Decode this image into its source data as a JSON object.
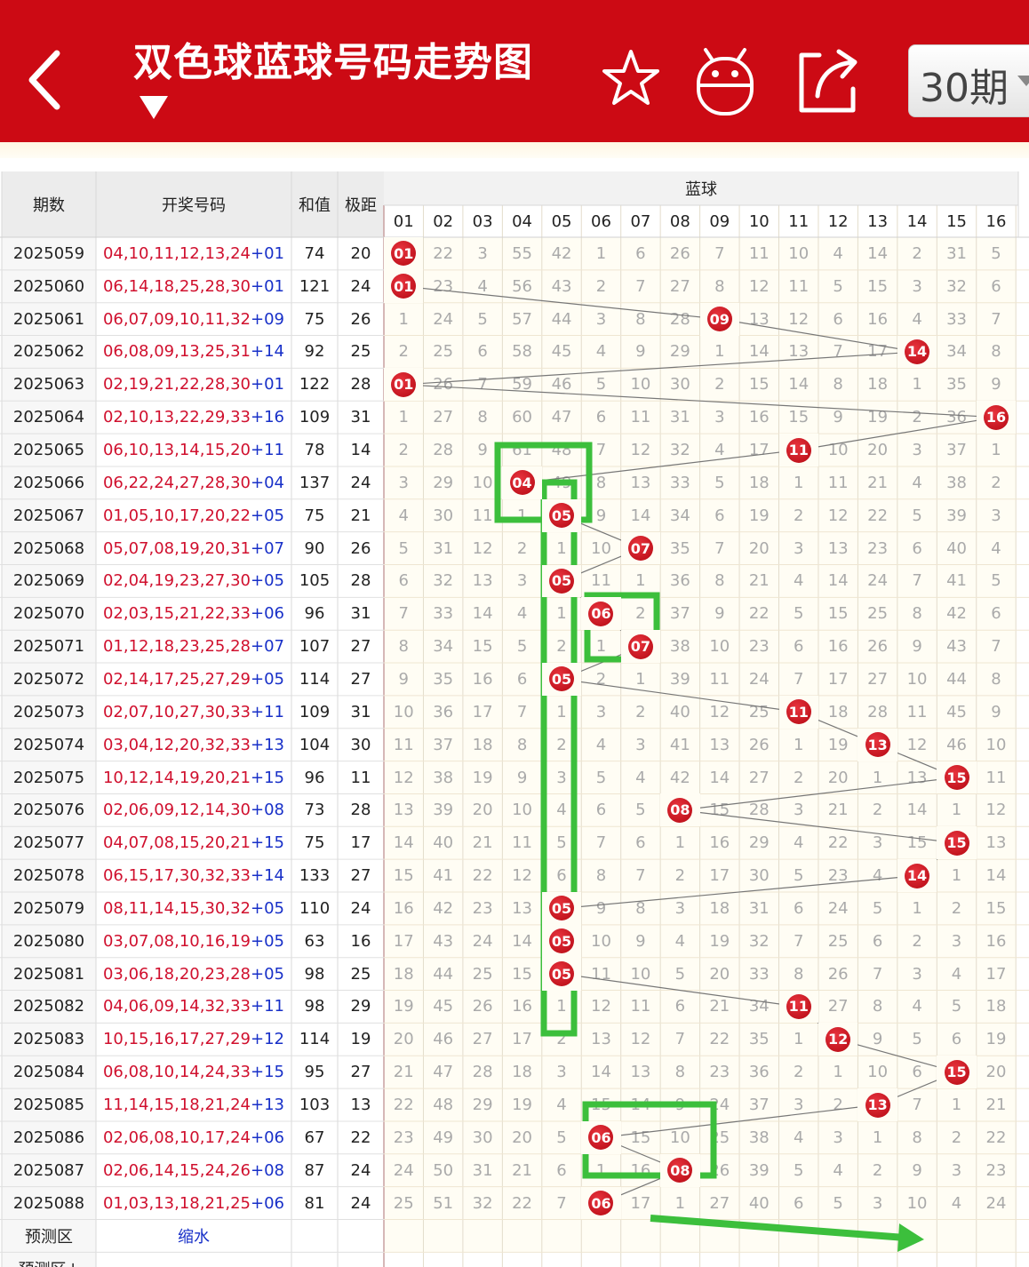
{
  "header": {
    "title": "双色球蓝球号码走势图",
    "period": "30期"
  },
  "icons": {
    "back": "back-icon",
    "dropdown": "dropdown-triangle-icon",
    "favorite": "star-icon",
    "android": "android-icon",
    "share": "share-icon"
  },
  "colors": {
    "brand": "#cc0a14",
    "ball": "#cc0a14",
    "highlight": "#3cbf3c",
    "plus_blue": "#1830c8"
  },
  "table": {
    "col_period": "期数",
    "col_numbers": "开奖号码",
    "col_sum": "和值",
    "col_span": "极距",
    "group_label": "蓝球",
    "ball_headers": [
      "01",
      "02",
      "03",
      "04",
      "05",
      "06",
      "07",
      "08",
      "09",
      "10",
      "11",
      "12",
      "13",
      "14",
      "15",
      "16"
    ],
    "rows": [
      {
        "period": "2025059",
        "red": "04,10,11,12,13,24",
        "blue": "+01",
        "sum": "74",
        "span": "20",
        "cells": [
          "01",
          "22",
          "3",
          "55",
          "42",
          "1",
          "6",
          "26",
          "7",
          "11",
          "10",
          "4",
          "14",
          "2",
          "31",
          "5"
        ],
        "hit": 0
      },
      {
        "period": "2025060",
        "red": "06,14,18,25,28,30",
        "blue": "+01",
        "sum": "121",
        "span": "24",
        "cells": [
          "01",
          "23",
          "4",
          "56",
          "43",
          "2",
          "7",
          "27",
          "8",
          "12",
          "11",
          "5",
          "15",
          "3",
          "32",
          "6"
        ],
        "hit": 0
      },
      {
        "period": "2025061",
        "red": "06,07,09,10,11,32",
        "blue": "+09",
        "sum": "75",
        "span": "26",
        "cells": [
          "1",
          "24",
          "5",
          "57",
          "44",
          "3",
          "8",
          "28",
          "09",
          "13",
          "12",
          "6",
          "16",
          "4",
          "33",
          "7"
        ],
        "hit": 8
      },
      {
        "period": "2025062",
        "red": "06,08,09,13,25,31",
        "blue": "+14",
        "sum": "92",
        "span": "25",
        "cells": [
          "2",
          "25",
          "6",
          "58",
          "45",
          "4",
          "9",
          "29",
          "1",
          "14",
          "13",
          "7",
          "17",
          "14",
          "34",
          "8"
        ],
        "hit": 13
      },
      {
        "period": "2025063",
        "red": "02,19,21,22,28,30",
        "blue": "+01",
        "sum": "122",
        "span": "28",
        "cells": [
          "01",
          "26",
          "7",
          "59",
          "46",
          "5",
          "10",
          "30",
          "2",
          "15",
          "14",
          "8",
          "18",
          "1",
          "35",
          "9"
        ],
        "hit": 0
      },
      {
        "period": "2025064",
        "red": "02,10,13,22,29,33",
        "blue": "+16",
        "sum": "109",
        "span": "31",
        "cells": [
          "1",
          "27",
          "8",
          "60",
          "47",
          "6",
          "11",
          "31",
          "3",
          "16",
          "15",
          "9",
          "19",
          "2",
          "36",
          "16"
        ],
        "hit": 15
      },
      {
        "period": "2025065",
        "red": "06,10,13,14,15,20",
        "blue": "+11",
        "sum": "78",
        "span": "14",
        "cells": [
          "2",
          "28",
          "9",
          "61",
          "48",
          "7",
          "12",
          "32",
          "4",
          "17",
          "11",
          "10",
          "20",
          "3",
          "37",
          "1"
        ],
        "hit": 10
      },
      {
        "period": "2025066",
        "red": "06,22,24,27,28,30",
        "blue": "+04",
        "sum": "137",
        "span": "24",
        "cells": [
          "3",
          "29",
          "10",
          "04",
          "49",
          "8",
          "13",
          "33",
          "5",
          "18",
          "1",
          "11",
          "21",
          "4",
          "38",
          "2"
        ],
        "hit": 3
      },
      {
        "period": "2025067",
        "red": "01,05,10,17,20,22",
        "blue": "+05",
        "sum": "75",
        "span": "21",
        "cells": [
          "4",
          "30",
          "11",
          "1",
          "05",
          "9",
          "14",
          "34",
          "6",
          "19",
          "2",
          "12",
          "22",
          "5",
          "39",
          "3"
        ],
        "hit": 4
      },
      {
        "period": "2025068",
        "red": "05,07,08,19,20,31",
        "blue": "+07",
        "sum": "90",
        "span": "26",
        "cells": [
          "5",
          "31",
          "12",
          "2",
          "1",
          "10",
          "07",
          "35",
          "7",
          "20",
          "3",
          "13",
          "23",
          "6",
          "40",
          "4"
        ],
        "hit": 6
      },
      {
        "period": "2025069",
        "red": "02,04,19,23,27,30",
        "blue": "+05",
        "sum": "105",
        "span": "28",
        "cells": [
          "6",
          "32",
          "13",
          "3",
          "05",
          "11",
          "1",
          "36",
          "8",
          "21",
          "4",
          "14",
          "24",
          "7",
          "41",
          "5"
        ],
        "hit": 4
      },
      {
        "period": "2025070",
        "red": "02,03,15,21,22,33",
        "blue": "+06",
        "sum": "96",
        "span": "31",
        "cells": [
          "7",
          "33",
          "14",
          "4",
          "1",
          "06",
          "2",
          "37",
          "9",
          "22",
          "5",
          "15",
          "25",
          "8",
          "42",
          "6"
        ],
        "hit": 5
      },
      {
        "period": "2025071",
        "red": "01,12,18,23,25,28",
        "blue": "+07",
        "sum": "107",
        "span": "27",
        "cells": [
          "8",
          "34",
          "15",
          "5",
          "2",
          "1",
          "07",
          "38",
          "10",
          "23",
          "6",
          "16",
          "26",
          "9",
          "43",
          "7"
        ],
        "hit": 6
      },
      {
        "period": "2025072",
        "red": "02,14,17,25,27,29",
        "blue": "+05",
        "sum": "114",
        "span": "27",
        "cells": [
          "9",
          "35",
          "16",
          "6",
          "05",
          "2",
          "1",
          "39",
          "11",
          "24",
          "7",
          "17",
          "27",
          "10",
          "44",
          "8"
        ],
        "hit": 4
      },
      {
        "period": "2025073",
        "red": "02,07,10,27,30,33",
        "blue": "+11",
        "sum": "109",
        "span": "31",
        "cells": [
          "10",
          "36",
          "17",
          "7",
          "1",
          "3",
          "2",
          "40",
          "12",
          "25",
          "11",
          "18",
          "28",
          "11",
          "45",
          "9"
        ],
        "hit": 10
      },
      {
        "period": "2025074",
        "red": "03,04,12,20,32,33",
        "blue": "+13",
        "sum": "104",
        "span": "30",
        "cells": [
          "11",
          "37",
          "18",
          "8",
          "2",
          "4",
          "3",
          "41",
          "13",
          "26",
          "1",
          "19",
          "13",
          "12",
          "46",
          "10"
        ],
        "hit": 12
      },
      {
        "period": "2025075",
        "red": "10,12,14,19,20,21",
        "blue": "+15",
        "sum": "96",
        "span": "11",
        "cells": [
          "12",
          "38",
          "19",
          "9",
          "3",
          "5",
          "4",
          "42",
          "14",
          "27",
          "2",
          "20",
          "1",
          "13",
          "15",
          "11"
        ],
        "hit": 14
      },
      {
        "period": "2025076",
        "red": "02,06,09,12,14,30",
        "blue": "+08",
        "sum": "73",
        "span": "28",
        "cells": [
          "13",
          "39",
          "20",
          "10",
          "4",
          "6",
          "5",
          "08",
          "15",
          "28",
          "3",
          "21",
          "2",
          "14",
          "1",
          "12"
        ],
        "hit": 7
      },
      {
        "period": "2025077",
        "red": "04,07,08,15,20,21",
        "blue": "+15",
        "sum": "75",
        "span": "17",
        "cells": [
          "14",
          "40",
          "21",
          "11",
          "5",
          "7",
          "6",
          "1",
          "16",
          "29",
          "4",
          "22",
          "3",
          "15",
          "15",
          "13"
        ],
        "hit": 14
      },
      {
        "period": "2025078",
        "red": "06,15,17,30,32,33",
        "blue": "+14",
        "sum": "133",
        "span": "27",
        "cells": [
          "15",
          "41",
          "22",
          "12",
          "6",
          "8",
          "7",
          "2",
          "17",
          "30",
          "5",
          "23",
          "4",
          "14",
          "1",
          "14"
        ],
        "hit": 13
      },
      {
        "period": "2025079",
        "red": "08,11,14,15,30,32",
        "blue": "+05",
        "sum": "110",
        "span": "24",
        "cells": [
          "16",
          "42",
          "23",
          "13",
          "05",
          "9",
          "8",
          "3",
          "18",
          "31",
          "6",
          "24",
          "5",
          "1",
          "2",
          "15"
        ],
        "hit": 4
      },
      {
        "period": "2025080",
        "red": "03,07,08,10,16,19",
        "blue": "+05",
        "sum": "63",
        "span": "16",
        "cells": [
          "17",
          "43",
          "24",
          "14",
          "05",
          "10",
          "9",
          "4",
          "19",
          "32",
          "7",
          "25",
          "6",
          "2",
          "3",
          "16"
        ],
        "hit": 4
      },
      {
        "period": "2025081",
        "red": "03,06,18,20,23,28",
        "blue": "+05",
        "sum": "98",
        "span": "25",
        "cells": [
          "18",
          "44",
          "25",
          "15",
          "05",
          "11",
          "10",
          "5",
          "20",
          "33",
          "8",
          "26",
          "7",
          "3",
          "4",
          "17"
        ],
        "hit": 4
      },
      {
        "period": "2025082",
        "red": "04,06,09,14,32,33",
        "blue": "+11",
        "sum": "98",
        "span": "29",
        "cells": [
          "19",
          "45",
          "26",
          "16",
          "1",
          "12",
          "11",
          "6",
          "21",
          "34",
          "11",
          "27",
          "8",
          "4",
          "5",
          "18"
        ],
        "hit": 10
      },
      {
        "period": "2025083",
        "red": "10,15,16,17,27,29",
        "blue": "+12",
        "sum": "114",
        "span": "19",
        "cells": [
          "20",
          "46",
          "27",
          "17",
          "2",
          "13",
          "12",
          "7",
          "22",
          "35",
          "1",
          "12",
          "9",
          "5",
          "6",
          "19"
        ],
        "hit": 11
      },
      {
        "period": "2025084",
        "red": "06,08,10,14,24,33",
        "blue": "+15",
        "sum": "95",
        "span": "27",
        "cells": [
          "21",
          "47",
          "28",
          "18",
          "3",
          "14",
          "13",
          "8",
          "23",
          "36",
          "2",
          "1",
          "10",
          "6",
          "15",
          "20"
        ],
        "hit": 14
      },
      {
        "period": "2025085",
        "red": "11,14,15,18,21,24",
        "blue": "+13",
        "sum": "103",
        "span": "13",
        "cells": [
          "22",
          "48",
          "29",
          "19",
          "4",
          "15",
          "14",
          "9",
          "24",
          "37",
          "3",
          "2",
          "13",
          "7",
          "1",
          "21"
        ],
        "hit": 12
      },
      {
        "period": "2025086",
        "red": "02,06,08,10,17,24",
        "blue": "+06",
        "sum": "67",
        "span": "22",
        "cells": [
          "23",
          "49",
          "30",
          "20",
          "5",
          "06",
          "15",
          "10",
          "25",
          "38",
          "4",
          "3",
          "1",
          "8",
          "2",
          "22"
        ],
        "hit": 5
      },
      {
        "period": "2025087",
        "red": "02,06,14,15,24,26",
        "blue": "+08",
        "sum": "87",
        "span": "24",
        "cells": [
          "24",
          "50",
          "31",
          "21",
          "6",
          "1",
          "16",
          "08",
          "26",
          "39",
          "5",
          "4",
          "2",
          "9",
          "3",
          "23"
        ],
        "hit": 7
      },
      {
        "period": "2025088",
        "red": "01,03,13,18,21,25",
        "blue": "+06",
        "sum": "81",
        "span": "24",
        "cells": [
          "25",
          "51",
          "32",
          "22",
          "7",
          "06",
          "17",
          "1",
          "27",
          "40",
          "6",
          "5",
          "3",
          "10",
          "4",
          "24"
        ],
        "hit": 5
      }
    ],
    "predict_label": "预测区",
    "predict_value": "缩水",
    "predict_label2": "预测区↓"
  }
}
